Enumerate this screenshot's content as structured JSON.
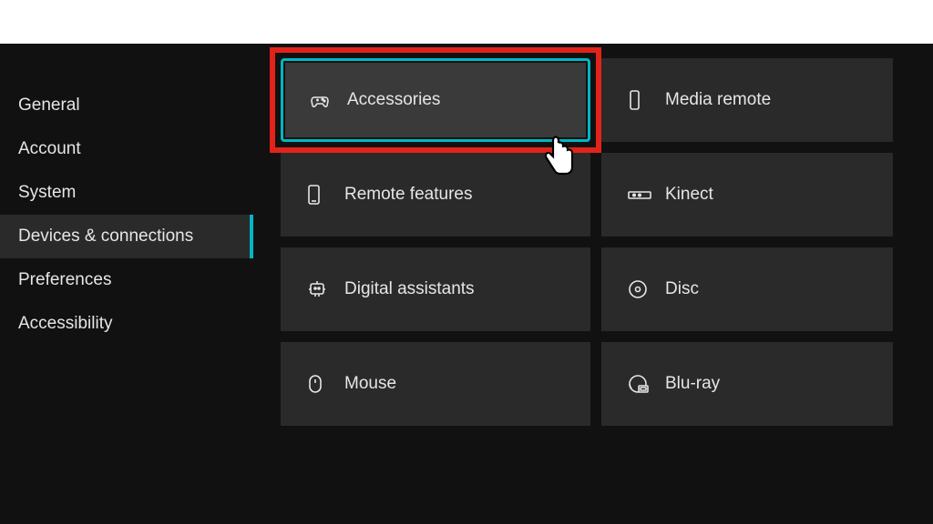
{
  "sidebar": {
    "items": [
      {
        "label": "General",
        "active": false,
        "name": "sidebar-item-general"
      },
      {
        "label": "Account",
        "active": false,
        "name": "sidebar-item-account"
      },
      {
        "label": "System",
        "active": false,
        "name": "sidebar-item-system"
      },
      {
        "label": "Devices & connections",
        "active": true,
        "name": "sidebar-item-devices-connections"
      },
      {
        "label": "Preferences",
        "active": false,
        "name": "sidebar-item-preferences"
      },
      {
        "label": "Accessibility",
        "active": false,
        "name": "sidebar-item-accessibility"
      }
    ]
  },
  "tiles": {
    "accessories": {
      "label": "Accessories",
      "selected": true
    },
    "media_remote": {
      "label": "Media remote",
      "selected": false
    },
    "remote_features": {
      "label": "Remote features",
      "selected": false
    },
    "kinect": {
      "label": "Kinect",
      "selected": false
    },
    "digital_assist": {
      "label": "Digital assistants",
      "selected": false
    },
    "disc": {
      "label": "Disc",
      "selected": false
    },
    "mouse": {
      "label": "Mouse",
      "selected": false
    },
    "blu_ray": {
      "label": "Blu-ray",
      "selected": false
    }
  }
}
